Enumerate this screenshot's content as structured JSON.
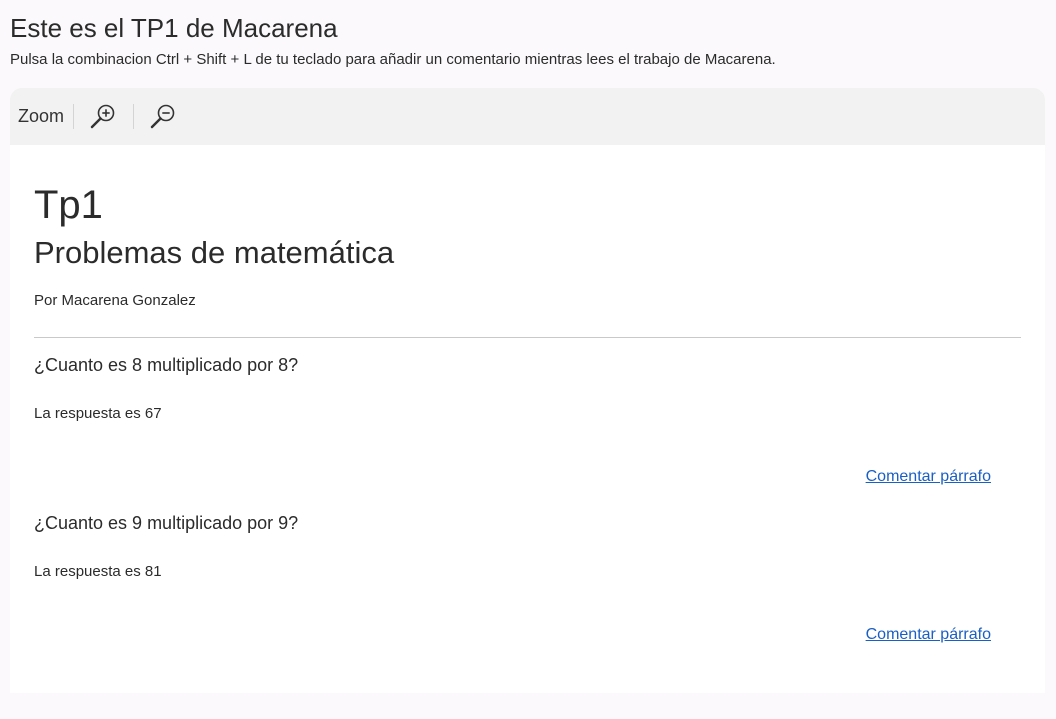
{
  "header": {
    "title": "Este es el TP1 de Macarena",
    "instructions": "Pulsa la combinacion Ctrl + Shift + L de tu teclado para añadir un comentario mientras lees el trabajo de Macarena."
  },
  "toolbar": {
    "zoom_label": "Zoom",
    "zoom_in_icon": "zoom-in-icon",
    "zoom_out_icon": "zoom-out-icon"
  },
  "document": {
    "title": "Tp1",
    "subtitle": "Problemas de matemática",
    "byline": "Por Macarena Gonzalez",
    "sections": [
      {
        "question": "¿Cuanto es 8 multiplicado por 8?",
        "answer": "La respuesta es 67",
        "comment_link": "Comentar párrafo"
      },
      {
        "question": "¿Cuanto es 9 multiplicado por 9?",
        "answer": "La respuesta es 81",
        "comment_link": "Comentar párrafo"
      }
    ]
  },
  "colors": {
    "link": "#1a5fc4",
    "toolbar_bg": "#f2f2f2",
    "page_bg": "#fbf9fc"
  }
}
